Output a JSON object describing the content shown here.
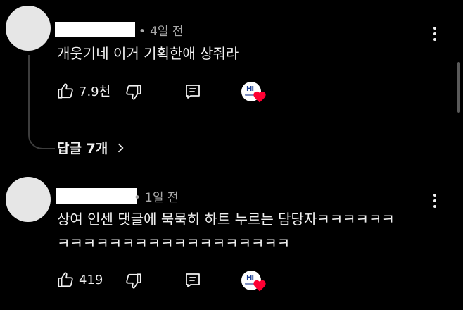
{
  "comments": [
    {
      "time_ago": "4일 전",
      "text": "개웃기네 이거 기획한애 상줘라",
      "like_count": "7.9천",
      "replies_label": "답글 7개"
    },
    {
      "time_ago": "1일 전",
      "text_line1": "상여 인센 댓글에 묵묵히 하트 누르는 담당자ㅋㅋㅋㅋㅋㅋ",
      "text_line2": "ㅋㅋㅋㅋㅋㅋㅋㅋㅋㅋㅋㅋㅋㅋㅋㅋㅋㅋ",
      "like_count": "419"
    }
  ],
  "icons": {
    "like": "thumbs-up-icon",
    "dislike": "thumbs-down-icon",
    "reply": "reply-icon",
    "more": "more-vertical-icon",
    "replies_chevron": "chevron-right-icon",
    "creator_heart": "creator-heart-icon"
  },
  "colors": {
    "background": "#000000",
    "text": "#f1f1f1",
    "meta": "#aaaaaa",
    "heart": "#ff0033",
    "thread_line": "#3d3d3d"
  }
}
